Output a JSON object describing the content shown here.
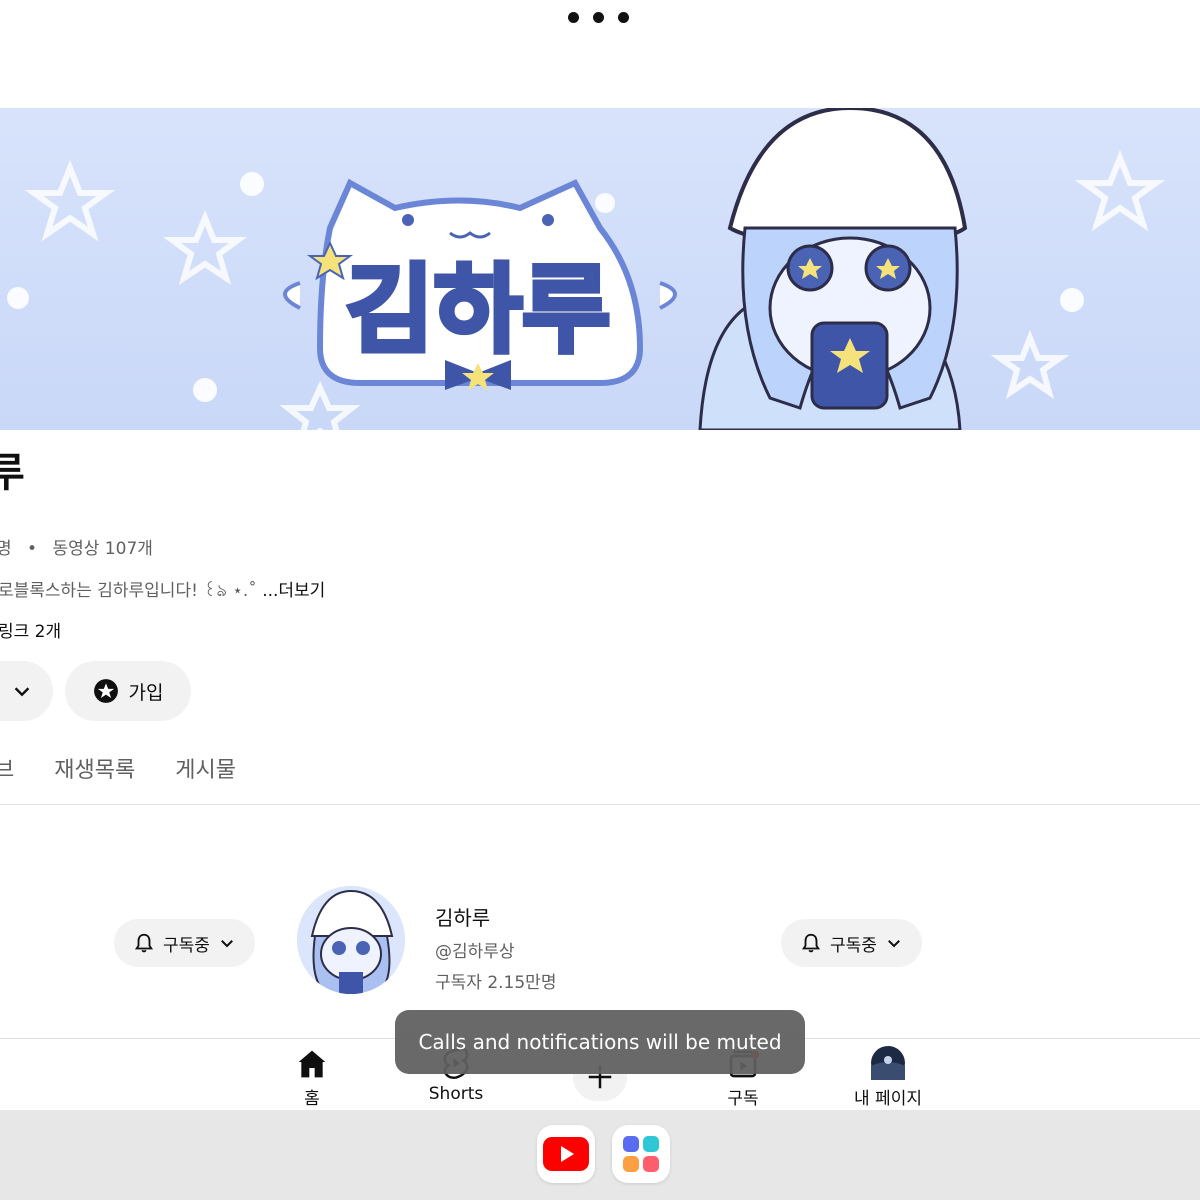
{
  "status_bar": {
    "menu_icon": "more-dots-icon"
  },
  "banner": {
    "logo_text": "김하루"
  },
  "channel": {
    "title": "루",
    "subscribers_partial": "명",
    "separator": "•",
    "videos": "동영상 107개",
    "description": "로블록스하는 김하루입니다! ꒰ঌ ⋆.˚",
    "more_label": "...더보기",
    "links": "링크 2개",
    "join_label": "가입"
  },
  "tabs": [
    {
      "label": "브"
    },
    {
      "label": "재생목록"
    },
    {
      "label": "게시물"
    }
  ],
  "subscription_row": {
    "left_button_label": "구독중",
    "right_button_label": "구독중",
    "name": "김하루",
    "handle": "@김하루상",
    "subscribers": "구독자 2.15만명"
  },
  "bottom_nav": {
    "home": "홈",
    "shorts": "Shorts",
    "subscriptions": "구독",
    "mypage": "내 페이지"
  },
  "toast": {
    "message": "Calls and notifications will be muted"
  },
  "colors": {
    "banner_bg": "#d8e3fb",
    "accent_blue": "#5a78c8",
    "youtube_red": "#ff0000",
    "pill_bg": "#f2f2f2"
  }
}
